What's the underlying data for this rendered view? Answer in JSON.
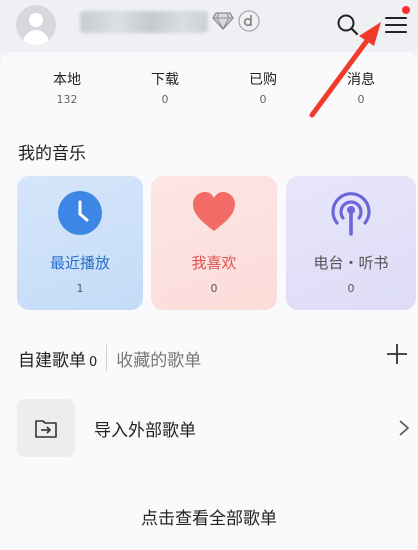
{
  "header": {
    "avatar_icon": "default-avatar",
    "badges": [
      "diamond-badge",
      "d-badge"
    ],
    "search_icon": "search-icon",
    "menu_icon": "hamburger-menu-icon",
    "notification_dot_color": "#ff2f2f"
  },
  "stats": [
    {
      "label": "本地",
      "count": "132"
    },
    {
      "label": "下载",
      "count": "0"
    },
    {
      "label": "已购",
      "count": "0"
    },
    {
      "label": "消息",
      "count": "0"
    }
  ],
  "my_music": {
    "title": "我的音乐",
    "cards": [
      {
        "label": "最近播放",
        "count": "1",
        "icon": "clock-icon",
        "accent": "#2a6fc9"
      },
      {
        "label": "我喜欢",
        "count": "0",
        "icon": "heart-icon",
        "accent": "#e0524e"
      },
      {
        "label": "电台・听",
        "badge": "书",
        "count": "0",
        "icon": "radio-tower-icon",
        "accent": "#6b66d9"
      }
    ]
  },
  "playlists": {
    "own_tab": "自建歌单",
    "own_count": "0",
    "fav_tab": "收藏的歌单",
    "add_icon": "plus-icon"
  },
  "import": {
    "label": "导入外部歌单",
    "icon": "folder-import-icon"
  },
  "view_all": "点击查看全部歌单",
  "annotation": {
    "arrow_color": "#f03a2a"
  }
}
